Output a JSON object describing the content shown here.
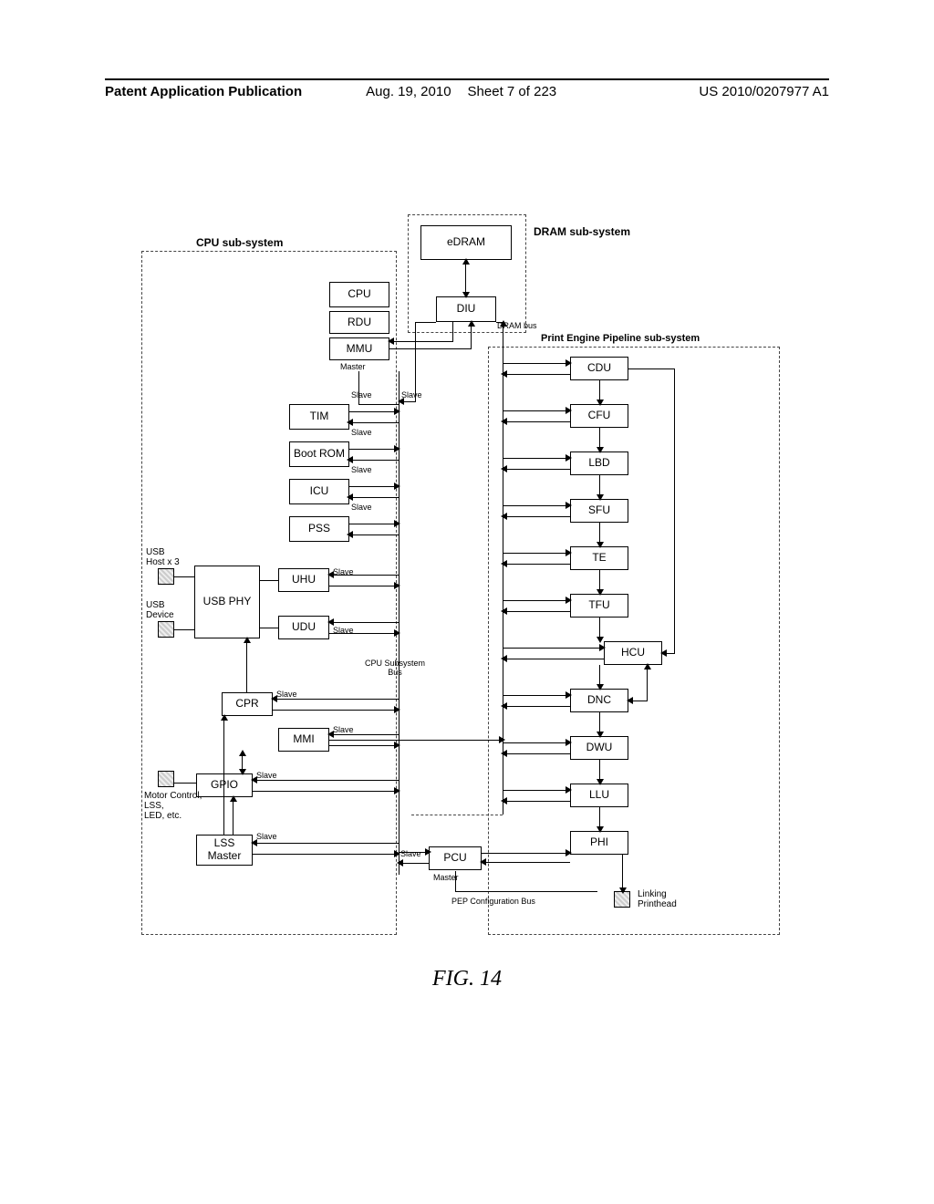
{
  "header": {
    "publication": "Patent Application Publication",
    "date": "Aug. 19, 2010",
    "sheet": "Sheet 7 of 223",
    "docnum": "US 2010/0207977 A1"
  },
  "titles": {
    "cpu": "CPU sub-system",
    "dram": "DRAM sub-system",
    "pep": "Print Engine Pipeline sub-system"
  },
  "blocks": {
    "edram": "eDRAM",
    "cpu": "CPU",
    "rdu": "RDU",
    "mmu": "MMU",
    "diu": "DIU",
    "tim": "TIM",
    "bootrom": "Boot ROM",
    "icu": "ICU",
    "pss": "PSS",
    "uhu": "UHU",
    "udu": "UDU",
    "usbphy": "USB PHY",
    "cpr": "CPR",
    "mmi": "MMI",
    "gpio": "GPIO",
    "lss": "LSS\nMaster",
    "pcu": "PCU",
    "cdu": "CDU",
    "cfu": "CFU",
    "lbd": "LBD",
    "sfu": "SFU",
    "te": "TE",
    "tfu": "TFU",
    "hcu": "HCU",
    "dnc": "DNC",
    "dwu": "DWU",
    "llu": "LLU",
    "phi": "PHI"
  },
  "labels": {
    "master": "Master",
    "slave": "Slave",
    "drambus": "DRAM bus",
    "cpubus": "CPU Subsystem\nBus",
    "pepcfg": "PEP Configuration Bus",
    "usbhost": "USB\nHost x 3",
    "usbdev": "USB\nDevice",
    "motor": "Motor Control,\nLSS,\nLED, etc.",
    "linking": "Linking\nPrinthead"
  },
  "caption": "FIG. 14"
}
